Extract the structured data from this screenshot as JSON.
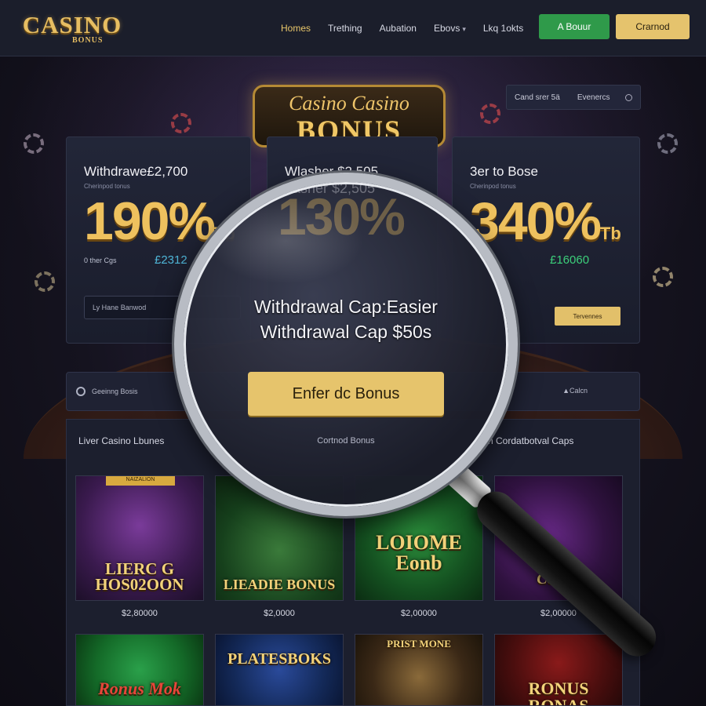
{
  "header": {
    "logo_text": "CASINO",
    "logo_sub": "BONUS",
    "nav": [
      {
        "label": "Homes",
        "active": true
      },
      {
        "label": "Trething",
        "active": false
      },
      {
        "label": "Aubation",
        "active": false
      },
      {
        "label": "Ebovs",
        "active": false,
        "dropdown": true
      },
      {
        "label": "Lkq 1okts",
        "active": false
      }
    ],
    "primary_button": "A Bouur",
    "secondary_button": "Crarnod"
  },
  "hero": {
    "banner_line1": "Casino Casino",
    "banner_line2": "BONUS",
    "region_select": {
      "left": "Cand srer 5ä",
      "right": "Evenercs"
    }
  },
  "cards": [
    {
      "title": "Withdrawe£2,700",
      "sub": "Cherinpod tonus",
      "percent": "190%",
      "suffix": "Tb",
      "row_label": "0 ther Cgs",
      "row_value": "£2312",
      "input_text": "Ly Hane Banwod"
    },
    {
      "title": "Wlasher $2,505",
      "sub": "",
      "percent": "130%",
      "suffix": "",
      "row_label": "",
      "row_value": "",
      "input_text": ""
    },
    {
      "title": "3er to Bose",
      "sub": "Cherinpod tonus",
      "percent": "340%",
      "suffix": "Tb",
      "row_label": "",
      "row_value": "£16060",
      "button": "Tervennes"
    }
  ],
  "status_bar": {
    "left": "Geeinng Bosis",
    "right": "▲Calcn"
  },
  "magnifier": {
    "line1": "Withdrawal Cap:Easier",
    "line2": "Withdrawal Cap $50s",
    "button": "Enfer dc Bonus",
    "caption": "Cortnod Bonus"
  },
  "games": {
    "section_left": "Liver Casino Lbunes",
    "section_right": "h Cordatbotval Caps",
    "tiles_row1": [
      {
        "title": "LIERC G\nHOS02OON",
        "price": "$2,80000",
        "ribbon": "NAIZALION"
      },
      {
        "title": "LIEADIE BONUS",
        "price": "$2,0000"
      },
      {
        "title": "LOIOME\nEonb",
        "price": "$2,00000"
      },
      {
        "title": "Celeus",
        "price": "$2,00000"
      }
    ],
    "tiles_row2": [
      {
        "title": "Ronus Mok"
      },
      {
        "title": "PLATESBOKS"
      },
      {
        "title": "PRIST MONE"
      },
      {
        "title": "RONUS\nRONAS"
      }
    ]
  },
  "colors": {
    "accent_gold": "#e6c46c",
    "accent_green": "#2f9a4a",
    "background": "#15131f"
  }
}
